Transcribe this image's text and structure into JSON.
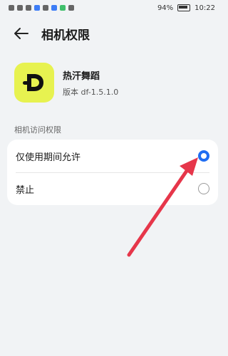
{
  "status_bar": {
    "battery": "94%",
    "time": "10:22"
  },
  "header": {
    "title": "相机权限"
  },
  "app": {
    "name": "热汗舞蹈",
    "version": "版本 df-1.5.1.0"
  },
  "section": {
    "label": "相机访问权限"
  },
  "options": [
    {
      "label": "仅使用期间允许",
      "selected": true
    },
    {
      "label": "禁止",
      "selected": false
    }
  ],
  "colors": {
    "background": "#f1f3f5",
    "accent_blue": "#1f6df2",
    "app_icon_bg": "#e7f250",
    "annotation_arrow": "#e6364a"
  },
  "icons": {
    "back": "arrow-left-icon",
    "app": "app-logo-icon"
  }
}
